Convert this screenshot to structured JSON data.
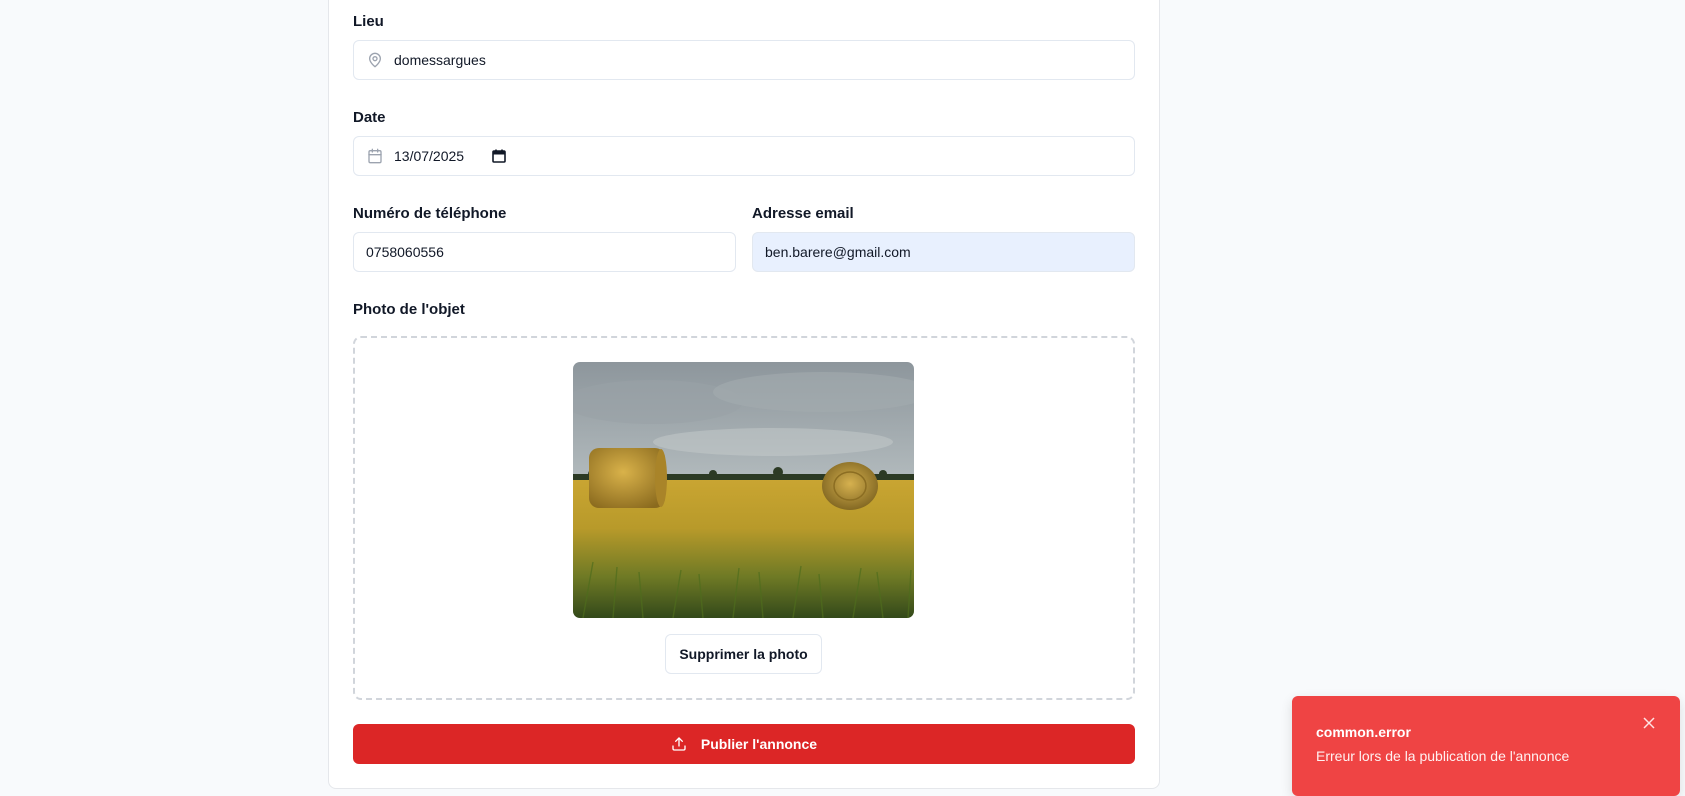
{
  "form": {
    "location": {
      "label": "Lieu",
      "value": "domessargues",
      "icon": "map-pin-icon"
    },
    "date": {
      "label": "Date",
      "value": "13/07/2025",
      "icon": "calendar-icon"
    },
    "phone": {
      "label": "Numéro de téléphone",
      "value": "0758060556"
    },
    "email": {
      "label": "Adresse email",
      "value": "ben.barere@gmail.com"
    },
    "photo": {
      "label": "Photo de l'objet",
      "remove_label": "Supprimer la photo"
    },
    "submit": {
      "label": "Publier l'annonce",
      "icon": "upload-icon"
    }
  },
  "toast": {
    "title": "common.error",
    "description": "Erreur lors de la publication de l'annonce",
    "close_icon": "close-icon"
  },
  "colors": {
    "primary": "#dc2626",
    "toast_bg": "#ef4444",
    "autofill_bg": "#e8f0fe",
    "page_bg": "#f8fafc"
  }
}
